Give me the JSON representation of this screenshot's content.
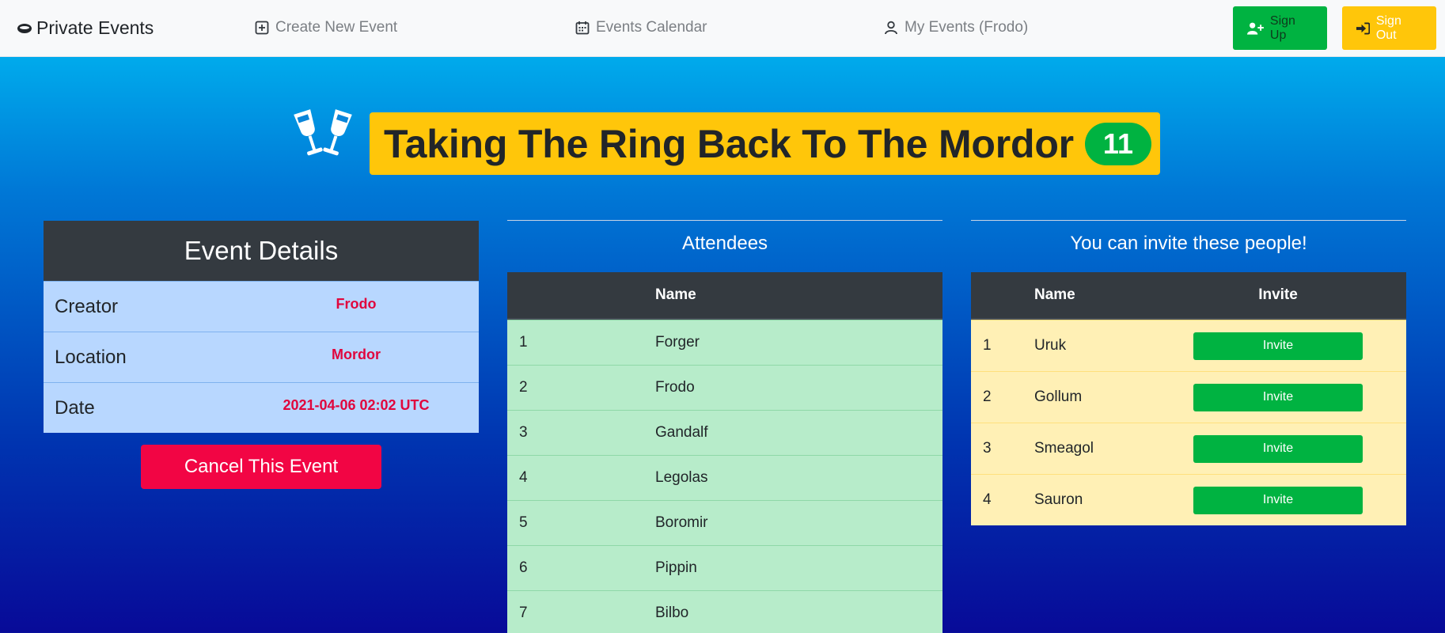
{
  "navbar": {
    "brand": "Private Events",
    "links": [
      {
        "label": "Create New Event",
        "icon": "plus-square-icon"
      },
      {
        "label": "Events Calendar",
        "icon": "calendar-icon"
      },
      {
        "label": "My Events (Frodo)",
        "icon": "user-icon"
      }
    ],
    "signup_label": "Sign Up",
    "signout_label": "Sign Out"
  },
  "event": {
    "title": "Taking The Ring Back To The Mordor",
    "attendee_count": "11",
    "icon": "glass-cheers-icon"
  },
  "details": {
    "heading": "Event Details",
    "rows": [
      {
        "label": "Creator",
        "value": "Frodo"
      },
      {
        "label": "Location",
        "value": "Mordor"
      },
      {
        "label": "Date",
        "value": "2021-04-06 02:02 UTC"
      }
    ],
    "cancel_label": "Cancel This Event"
  },
  "attendees": {
    "title": "Attendees",
    "header_name": "Name",
    "rows": [
      {
        "num": "1",
        "name": "Forger"
      },
      {
        "num": "2",
        "name": "Frodo"
      },
      {
        "num": "3",
        "name": "Gandalf"
      },
      {
        "num": "4",
        "name": "Legolas"
      },
      {
        "num": "5",
        "name": "Boromir"
      },
      {
        "num": "6",
        "name": "Pippin"
      },
      {
        "num": "7",
        "name": "Bilbo"
      }
    ]
  },
  "invitable": {
    "title": "You can invite these people!",
    "header_name": "Name",
    "header_invite": "Invite",
    "button_label": "Invite",
    "rows": [
      {
        "num": "1",
        "name": "Uruk"
      },
      {
        "num": "2",
        "name": "Gollum"
      },
      {
        "num": "3",
        "name": "Smeagol"
      },
      {
        "num": "4",
        "name": "Sauron"
      }
    ]
  },
  "colors": {
    "success": "#00b341",
    "warning": "#ffc60a",
    "danger": "#f20544",
    "dark": "#343a40"
  }
}
